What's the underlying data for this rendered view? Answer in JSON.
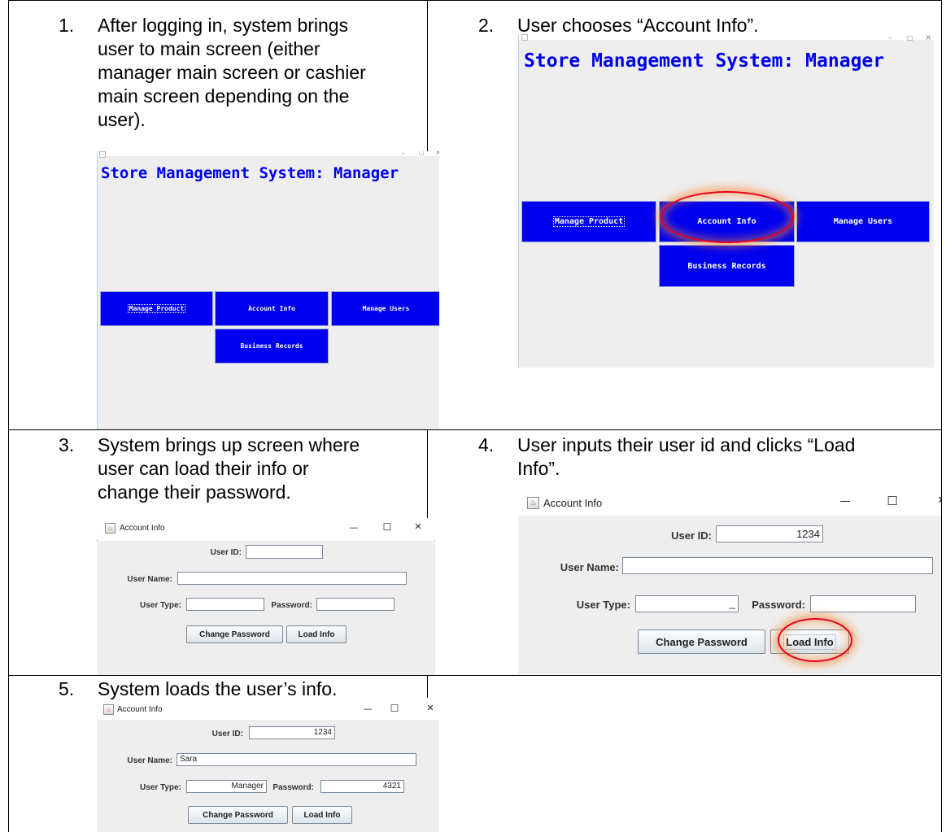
{
  "steps": [
    {
      "num": "1.",
      "lines": [
        "After logging in, system brings",
        "user to main screen (either",
        "manager main screen or cashier",
        "main screen depending on the",
        "user)."
      ]
    },
    {
      "num": "2.",
      "lines": [
        "User chooses “Account Info”."
      ]
    },
    {
      "num": "3.",
      "lines": [
        "System brings up screen where",
        "user can load their info or",
        "change their password."
      ]
    },
    {
      "num": "4.",
      "lines": [
        "User inputs their user id and clicks “Load",
        "Info”."
      ]
    },
    {
      "num": "5.",
      "lines": [
        "System loads the user’s info."
      ]
    }
  ],
  "manager_screen": {
    "title": "Store Management System: Manager",
    "window_controls": {
      "minimize": "–",
      "maximize": "□",
      "close": "×"
    },
    "buttons": {
      "manage_product": "Manage Product",
      "account_info": "Account Info",
      "manage_users": "Manage Users",
      "business_records": "Business Records"
    }
  },
  "account_info": {
    "window_title": "Account Info",
    "window_controls": {
      "minimize": "—",
      "maximize": "☐",
      "close": "✕"
    },
    "labels": {
      "user_id": "User ID:",
      "user_name": "User Name:",
      "user_type": "User Type:",
      "password": "Password:"
    },
    "buttons": {
      "change_password": "Change Password",
      "load_info": "Load Info"
    },
    "step3_values": {
      "user_id": "",
      "user_name": "",
      "user_type": "",
      "password": ""
    },
    "step4_values": {
      "user_id": "1234",
      "user_name": "",
      "user_type": "_",
      "password": ""
    },
    "step5_values": {
      "user_id": "1234",
      "user_name": "Sara",
      "user_type": "Manager",
      "password": "4321"
    }
  },
  "colors": {
    "manager_title": "#0000ee",
    "manager_button": "#0000ee",
    "window_background": "#eeeeee",
    "highlight_ring": "#e8001c"
  }
}
